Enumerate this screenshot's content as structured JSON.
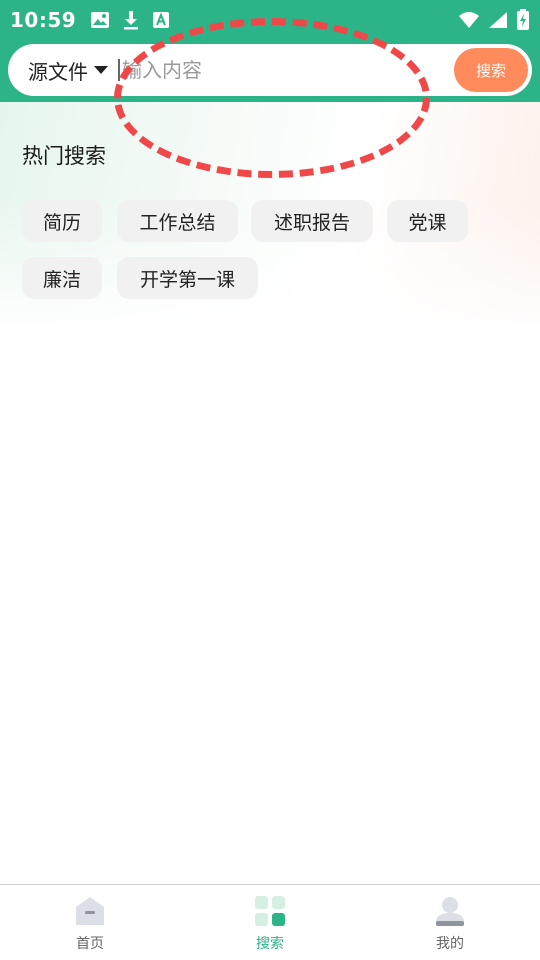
{
  "status_bar": {
    "time": "10:59",
    "icons_left": [
      "image-icon",
      "download-icon",
      "font-icon"
    ],
    "icons_right": [
      "wifi-icon",
      "signal-icon",
      "battery-charging-icon"
    ]
  },
  "search": {
    "source_label": "源文件",
    "placeholder": "输入内容",
    "value": "",
    "button_label": "搜索"
  },
  "hot_search": {
    "title": "热门搜索",
    "tags": [
      "简历",
      "工作总结",
      "述职报告",
      "党课",
      "廉洁",
      "开学第一课"
    ]
  },
  "tabbar": {
    "items": [
      {
        "label": "首页",
        "icon": "home-icon",
        "active": false
      },
      {
        "label": "搜索",
        "icon": "grid-icon",
        "active": true
      },
      {
        "label": "我的",
        "icon": "user-icon",
        "active": false
      }
    ]
  },
  "colors": {
    "primary": "#2db388",
    "search_button": "#ff8a5c",
    "annotation": "#f04848",
    "tag_bg": "#f1f1f1"
  }
}
